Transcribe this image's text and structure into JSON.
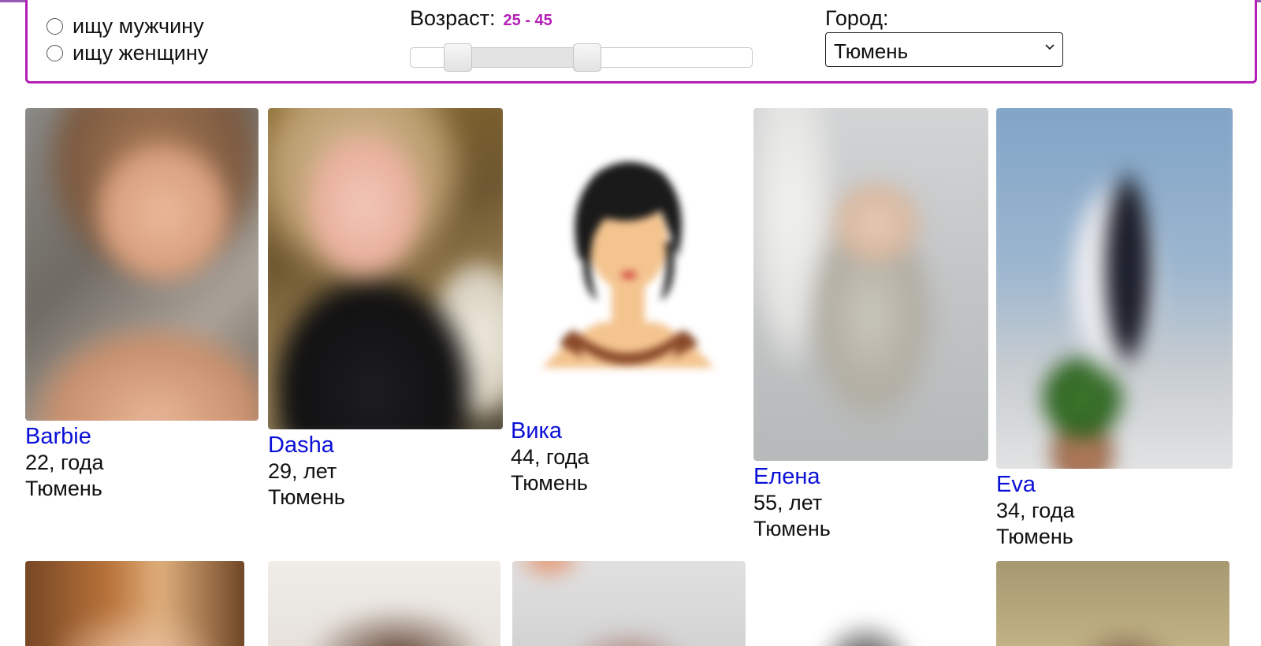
{
  "filter": {
    "gender_options": [
      {
        "label": "ищу мужчину",
        "selected": false
      },
      {
        "label": "ищу женщину",
        "selected": false
      }
    ],
    "age": {
      "label": "Возраст:",
      "range_text": "25 - 45",
      "min": 25,
      "max": 45
    },
    "city": {
      "label": "Город:",
      "selected": "Тюмень"
    },
    "accent_color": "#b31fb5"
  },
  "profiles": [
    {
      "name": "Barbie",
      "age": "22, года",
      "city": "Тюмень"
    },
    {
      "name": "Dasha",
      "age": "29, лет",
      "city": "Тюмень"
    },
    {
      "name": "Вика",
      "age": "44, года",
      "city": "Тюмень"
    },
    {
      "name": "Елена",
      "age": "55, лет",
      "city": "Тюмень"
    },
    {
      "name": "Eva",
      "age": "34, года",
      "city": "Тюмень"
    }
  ],
  "link_color": "#0a10d6"
}
